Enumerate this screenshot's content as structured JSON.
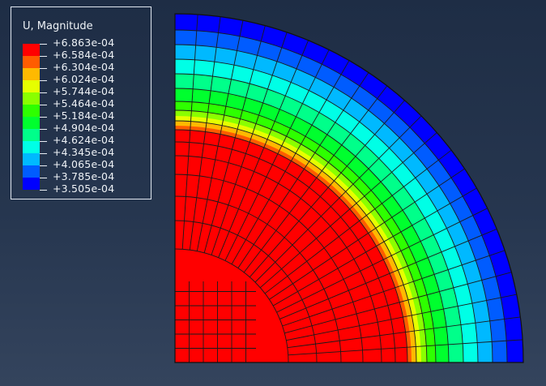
{
  "viewport": {
    "legend": {
      "title": "U, Magnitude",
      "values": [
        "+6.863e-04",
        "+6.584e-04",
        "+6.304e-04",
        "+6.024e-04",
        "+5.744e-04",
        "+5.464e-04",
        "+5.184e-04",
        "+4.904e-04",
        "+4.624e-04",
        "+4.345e-04",
        "+4.065e-04",
        "+3.785e-04",
        "+3.505e-04"
      ],
      "colors": [
        "#ff0000",
        "#ff5c00",
        "#ffb900",
        "#e6ff00",
        "#8aff00",
        "#2eff00",
        "#00ff2e",
        "#00ff8a",
        "#00ffe6",
        "#00b9ff",
        "#005cff",
        "#0000ff"
      ]
    },
    "contour_plot": {
      "field": "U, Magnitude",
      "shape": "quarter-circle",
      "band_colors_outer_to_inner": [
        "#0000ff",
        "#005cff",
        "#00b9ff",
        "#00ffe6",
        "#00ff8a",
        "#00ff2e",
        "#2eff00",
        "#8aff00",
        "#e6ff00",
        "#ffb900",
        "#ff5c00",
        "#ff0000"
      ]
    }
  }
}
